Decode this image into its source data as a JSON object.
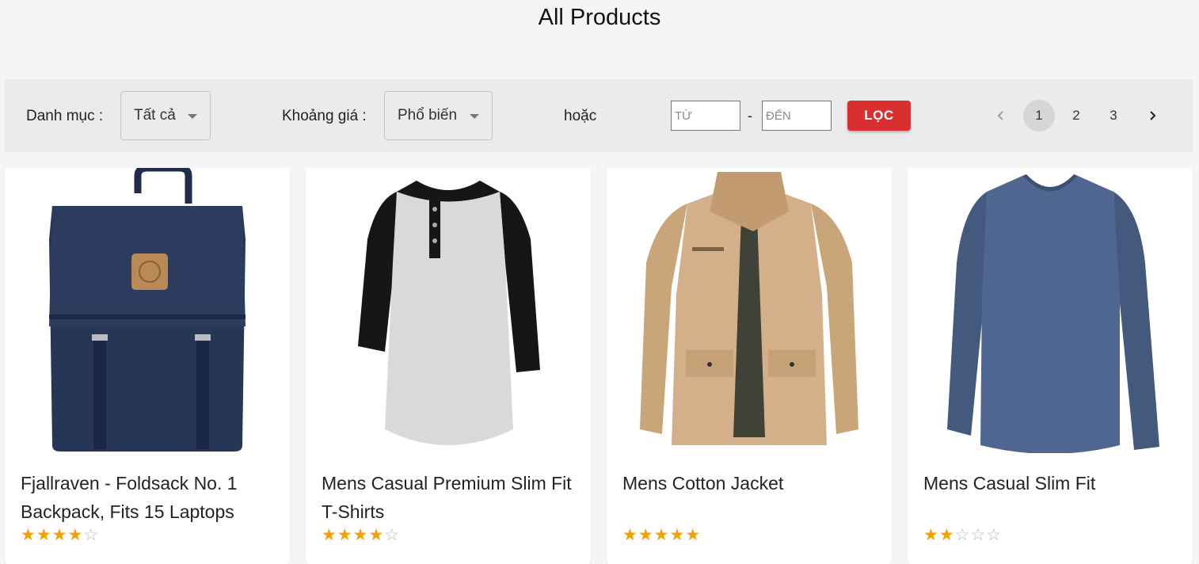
{
  "page": {
    "title": "All Products"
  },
  "filters": {
    "category_label": "Danh mục :",
    "category_value": "Tất cả",
    "price_label": "Khoảng giá :",
    "price_value": "Phổ biến",
    "or_label": "hoặc",
    "from_placeholder": "TỪ",
    "to_placeholder": "ĐẾN",
    "separator": "-",
    "filter_button": "LỌC"
  },
  "pagination": {
    "prev_icon": "chevron-left-icon",
    "next_icon": "chevron-right-icon",
    "pages": [
      "1",
      "2",
      "3"
    ],
    "current": "1"
  },
  "products": [
    {
      "title": "Fjallraven - Foldsack No. 1 Backpack, Fits 15 Laptops",
      "rating": 4,
      "image": "navy-backpack"
    },
    {
      "title": "Mens Casual Premium Slim Fit T-Shirts",
      "rating": 4,
      "image": "raglan-henley-shirt"
    },
    {
      "title": "Mens Cotton Jacket",
      "rating": 5,
      "image": "khaki-cotton-jacket"
    },
    {
      "title": "Mens Casual Slim Fit",
      "rating": 2,
      "image": "blue-longsleeve-shirt"
    }
  ],
  "colors": {
    "accent": "#d9302f",
    "star": "#f5a000",
    "background": "#f5f5f5"
  }
}
